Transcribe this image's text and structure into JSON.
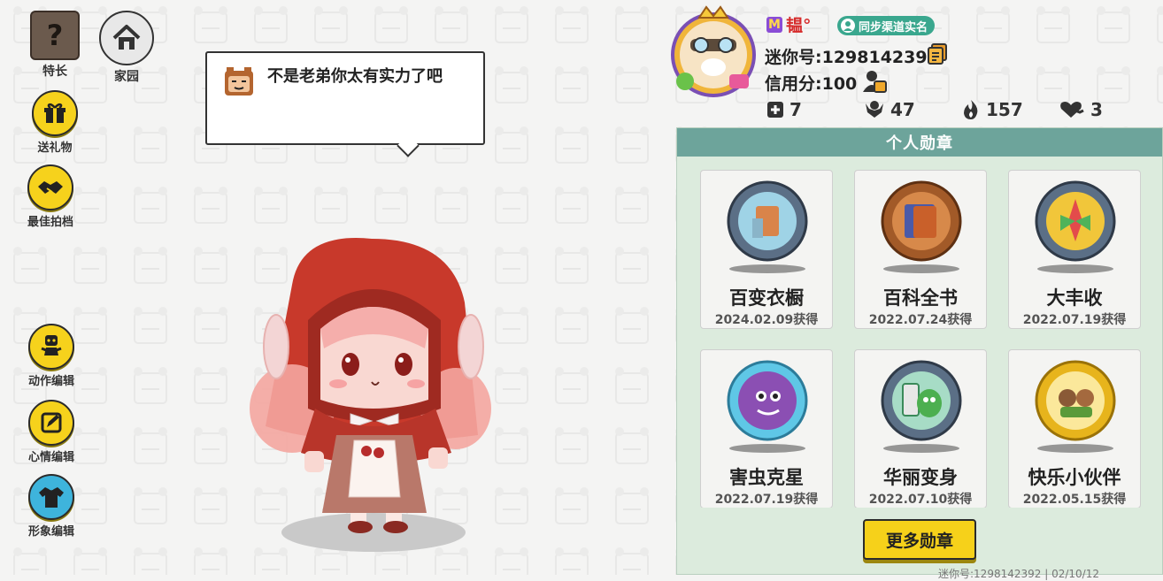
{
  "left_menu": {
    "specialty": "特长",
    "home": "家园",
    "gift": "送礼物",
    "best_pair": "最佳拍档",
    "action_edit": "动作编辑",
    "mood_edit": "心情编辑",
    "look_edit": "形象编辑"
  },
  "bubble": {
    "text": "不是老弟你太有实力了吧"
  },
  "profile": {
    "name": "韫°",
    "sync_label": "同步渠道实名",
    "mini_id": "迷你号:1298142392",
    "credit": "信用分:100",
    "stats": {
      "friends": "7",
      "fans": "47",
      "popularity": "157",
      "likes": "3"
    }
  },
  "medals": {
    "title": "个人勋章",
    "items": [
      {
        "name": "百变衣橱",
        "date": "2024.02.09获得",
        "ring": "#5b6f86",
        "fill": "#9fd3e6"
      },
      {
        "name": "百科全书",
        "date": "2022.07.24获得",
        "ring": "#a25a28",
        "fill": "#d7894a"
      },
      {
        "name": "大丰收",
        "date": "2022.07.19获得",
        "ring": "#5b6f86",
        "fill": "#f1c63a"
      },
      {
        "name": "害虫克星",
        "date": "2022.07.19获得",
        "ring": "#5fc7e6",
        "fill": "#8b4fb3"
      },
      {
        "name": "华丽变身",
        "date": "2022.07.10获得",
        "ring": "#5b6f86",
        "fill": "#a7dcc6"
      },
      {
        "name": "快乐小伙伴",
        "date": "2022.05.15获得",
        "ring": "#e7b41c",
        "fill": "#fbe89b"
      }
    ],
    "more_button": "更多勋章"
  },
  "footer": {
    "text": "迷你号:1298142392 | 02/10/12"
  },
  "colors": {
    "accent_yellow": "#f6d21c",
    "panel_header": "#6da49b",
    "panel_bg": "#dcebdd"
  }
}
